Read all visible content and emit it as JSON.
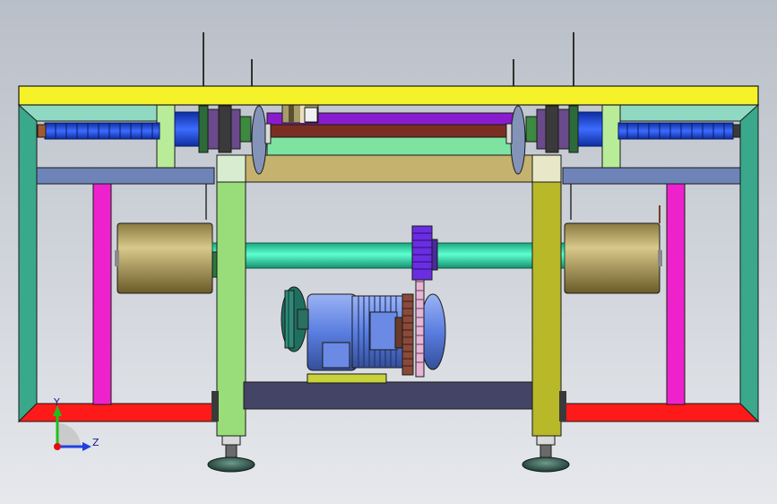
{
  "viewport": {
    "background_top": "#b9bfc8",
    "background_bottom": "#e6e8ec"
  },
  "colors": {
    "top_beam": "#f5f22a",
    "frame_teal": "#3aa88a",
    "frame_teal_light": "#8fd9c3",
    "base_red": "#ff1a1a",
    "post_magenta": "#ee22cc",
    "post_green": "#98dd7a",
    "post_olive": "#b8b828",
    "cross_beam_blue": "#6e84b8",
    "screw_blue": "#1f4fe0",
    "shaft_purple": "#8a1ccf",
    "shaft_brown": "#7a2e22",
    "slider_green": "#7ee2a0",
    "plate_tan": "#c4b26e",
    "roller_tan": "#bfae6a",
    "drive_shaft": "#2de8b4",
    "sprocket": "#6a2ee0",
    "motor_blue": "#5a7ee0",
    "pulley_teal": "#1f6f60",
    "chain_pink": "#e6b6d6",
    "base_plate": "#444466",
    "motor_mount": "#c8d23a",
    "foot_dark": "#2e4c44",
    "axis_y": "#1fbf1f",
    "axis_z": "#2040e0",
    "origin": "#e01010"
  },
  "icons": {
    "triad": "coordinate-triad-icon"
  },
  "triad": {
    "y_label": "Y",
    "z_label": "Z"
  }
}
